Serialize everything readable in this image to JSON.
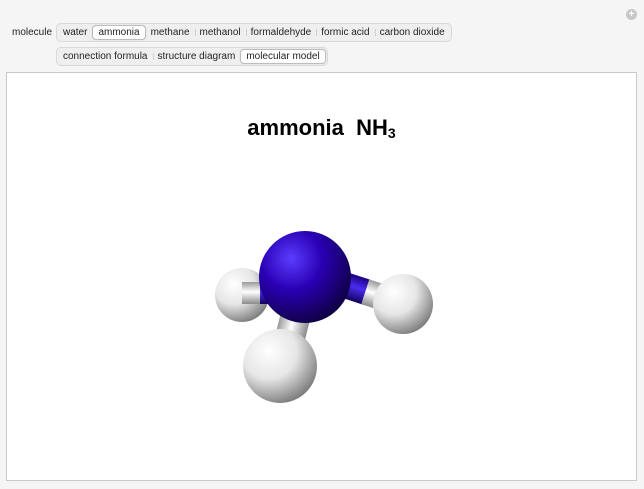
{
  "controls": {
    "molecule_label": "molecule",
    "molecules": [
      "water",
      "ammonia",
      "methane",
      "methanol",
      "formaldehyde",
      "formic acid",
      "carbon dioxide"
    ],
    "selected_molecule": "ammonia",
    "views": [
      "connection formula",
      "structure diagram",
      "molecular model"
    ],
    "selected_view": "molecular model"
  },
  "display": {
    "name": "ammonia",
    "formula_main": "NH",
    "formula_sub": "3"
  },
  "colors": {
    "nitrogen": "#2a00b4",
    "hydrogen": "#f0f0f0"
  },
  "icons": {
    "corner": "plus-icon"
  }
}
